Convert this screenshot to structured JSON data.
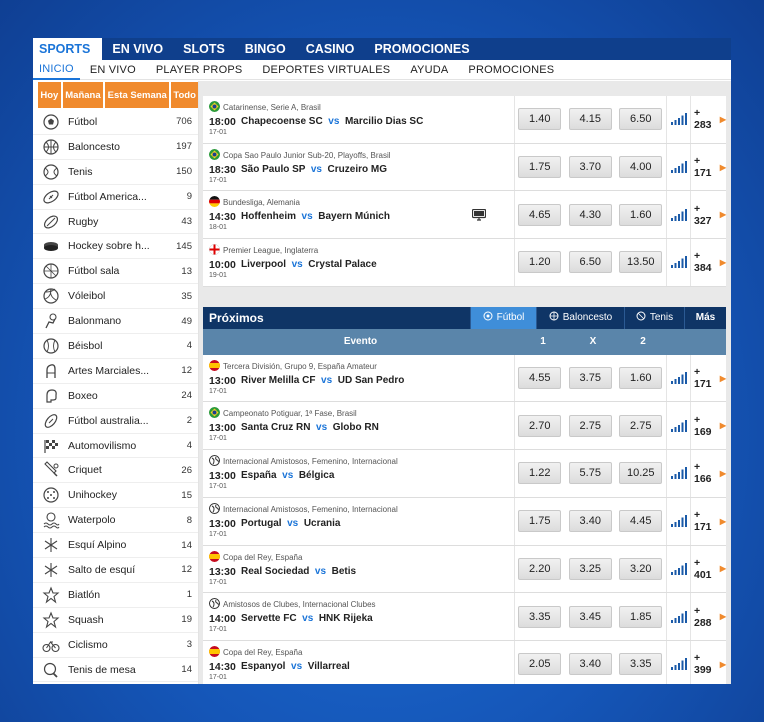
{
  "topnav": [
    "SPORTS",
    "EN VIVO",
    "SLOTS",
    "BINGO",
    "CASINO",
    "PROMOCIONES"
  ],
  "subnav": [
    "INICIO",
    "EN VIVO",
    "PLAYER PROPS",
    "DEPORTES VIRTUALES",
    "AYUDA",
    "PROMOCIONES"
  ],
  "sidebar": {
    "tabs": [
      "Hoy",
      "Mañana",
      "Esta Semana",
      "Todo"
    ],
    "sports": [
      {
        "name": "Fútbol",
        "count": "706",
        "icon": "soccer-ball-icon"
      },
      {
        "name": "Baloncesto",
        "count": "197",
        "icon": "basketball-icon"
      },
      {
        "name": "Tenis",
        "count": "150",
        "icon": "tennis-ball-icon"
      },
      {
        "name": "Fútbol America...",
        "count": "9",
        "icon": "american-football-icon"
      },
      {
        "name": "Rugby",
        "count": "43",
        "icon": "rugby-ball-icon"
      },
      {
        "name": "Hockey sobre h...",
        "count": "145",
        "icon": "hockey-puck-icon"
      },
      {
        "name": "Fútbol sala",
        "count": "13",
        "icon": "futsal-ball-icon"
      },
      {
        "name": "Vóleibol",
        "count": "35",
        "icon": "volleyball-icon"
      },
      {
        "name": "Balonmano",
        "count": "49",
        "icon": "handball-icon"
      },
      {
        "name": "Béisbol",
        "count": "4",
        "icon": "baseball-icon"
      },
      {
        "name": "Artes Marciales...",
        "count": "12",
        "icon": "martial-arts-icon"
      },
      {
        "name": "Boxeo",
        "count": "24",
        "icon": "boxing-glove-icon"
      },
      {
        "name": "Fútbol australia...",
        "count": "2",
        "icon": "aussie-football-icon"
      },
      {
        "name": "Automovilismo",
        "count": "4",
        "icon": "checkered-flag-icon"
      },
      {
        "name": "Criquet",
        "count": "26",
        "icon": "cricket-bat-icon"
      },
      {
        "name": "Unihockey",
        "count": "15",
        "icon": "floorball-icon"
      },
      {
        "name": "Waterpolo",
        "count": "8",
        "icon": "waterpolo-icon"
      },
      {
        "name": "Esquí Alpino",
        "count": "14",
        "icon": "snowflake-icon"
      },
      {
        "name": "Salto de esquí",
        "count": "12",
        "icon": "snowflake-icon"
      },
      {
        "name": "Biatlón",
        "count": "1",
        "icon": "star-icon"
      },
      {
        "name": "Squash",
        "count": "19",
        "icon": "star-icon"
      },
      {
        "name": "Ciclismo",
        "count": "3",
        "icon": "bicycle-icon"
      },
      {
        "name": "Tenis de mesa",
        "count": "14",
        "icon": "ping-pong-icon"
      }
    ]
  },
  "live_events": [
    {
      "comp": "Catarinense, Serie A, Brasil",
      "flag": "brazil",
      "time": "18:00",
      "date": "17-01",
      "home": "Chapecoense SC",
      "away": "Marcilio Dias SC",
      "odds": [
        "1.40",
        "4.15",
        "6.50"
      ],
      "more": "+ 283",
      "tv": false
    },
    {
      "comp": "Copa Sao Paulo Junior Sub-20, Playoffs, Brasil",
      "flag": "brazil",
      "time": "18:30",
      "date": "17-01",
      "home": "São Paulo SP",
      "away": "Cruzeiro MG",
      "odds": [
        "1.75",
        "3.70",
        "4.00"
      ],
      "more": "+ 171",
      "tv": false
    },
    {
      "comp": "Bundesliga, Alemania",
      "flag": "germany",
      "time": "14:30",
      "date": "18-01",
      "home": "Hoffenheim",
      "away": "Bayern Múnich",
      "odds": [
        "4.65",
        "4.30",
        "1.60"
      ],
      "more": "+ 327",
      "tv": true
    },
    {
      "comp": "Premier League, Inglaterra",
      "flag": "england",
      "time": "10:00",
      "date": "19-01",
      "home": "Liverpool",
      "away": "Crystal Palace",
      "odds": [
        "1.20",
        "6.50",
        "13.50"
      ],
      "more": "+ 384",
      "tv": false
    }
  ],
  "proximos": {
    "title": "Próximos",
    "tabs": [
      "Fútbol",
      "Baloncesto",
      "Tenis",
      "Más"
    ],
    "columns": {
      "event": "Evento",
      "one": "1",
      "x": "X",
      "two": "2"
    },
    "events": [
      {
        "comp": "Tercera División, Grupo 9, España Amateur",
        "flag": "spain",
        "time": "13:00",
        "date": "17-01",
        "home": "River Melilla CF",
        "away": "UD San Pedro",
        "odds": [
          "4.55",
          "3.75",
          "1.60"
        ],
        "more": "+ 171"
      },
      {
        "comp": "Campeonato Potiguar, 1ª Fase, Brasil",
        "flag": "brazil",
        "time": "13:00",
        "date": "17-01",
        "home": "Santa Cruz RN",
        "away": "Globo RN",
        "odds": [
          "2.70",
          "2.75",
          "2.75"
        ],
        "more": "+ 169"
      },
      {
        "comp": "Internacional Amistosos, Femenino, Internacional",
        "flag": "world",
        "time": "13:00",
        "date": "17-01",
        "home": "España",
        "away": "Bélgica",
        "odds": [
          "1.22",
          "5.75",
          "10.25"
        ],
        "more": "+ 166"
      },
      {
        "comp": "Internacional Amistosos, Femenino, Internacional",
        "flag": "world",
        "time": "13:00",
        "date": "17-01",
        "home": "Portugal",
        "away": "Ucrania",
        "odds": [
          "1.75",
          "3.40",
          "4.45"
        ],
        "more": "+ 171"
      },
      {
        "comp": "Copa del Rey, España",
        "flag": "spain",
        "time": "13:30",
        "date": "17-01",
        "home": "Real Sociedad",
        "away": "Betis",
        "odds": [
          "2.20",
          "3.25",
          "3.20"
        ],
        "more": "+ 401"
      },
      {
        "comp": "Amistosos de Clubes, Internacional Clubes",
        "flag": "world",
        "time": "14:00",
        "date": "17-01",
        "home": "Servette FC",
        "away": "HNK Rijeka",
        "odds": [
          "3.35",
          "3.45",
          "1.85"
        ],
        "more": "+ 288"
      },
      {
        "comp": "Copa del Rey, España",
        "flag": "spain",
        "time": "14:30",
        "date": "17-01",
        "home": "Espanyol",
        "away": "Villarreal",
        "odds": [
          "2.05",
          "3.40",
          "3.35"
        ],
        "more": "+ 399"
      }
    ]
  },
  "vs_label": "vs",
  "colors": {
    "nav": "#0f3f8c",
    "accent": "#1a74d8",
    "orange": "#f08a2d",
    "proximos_header": "#0f3566",
    "column_header": "#5a85aa"
  }
}
